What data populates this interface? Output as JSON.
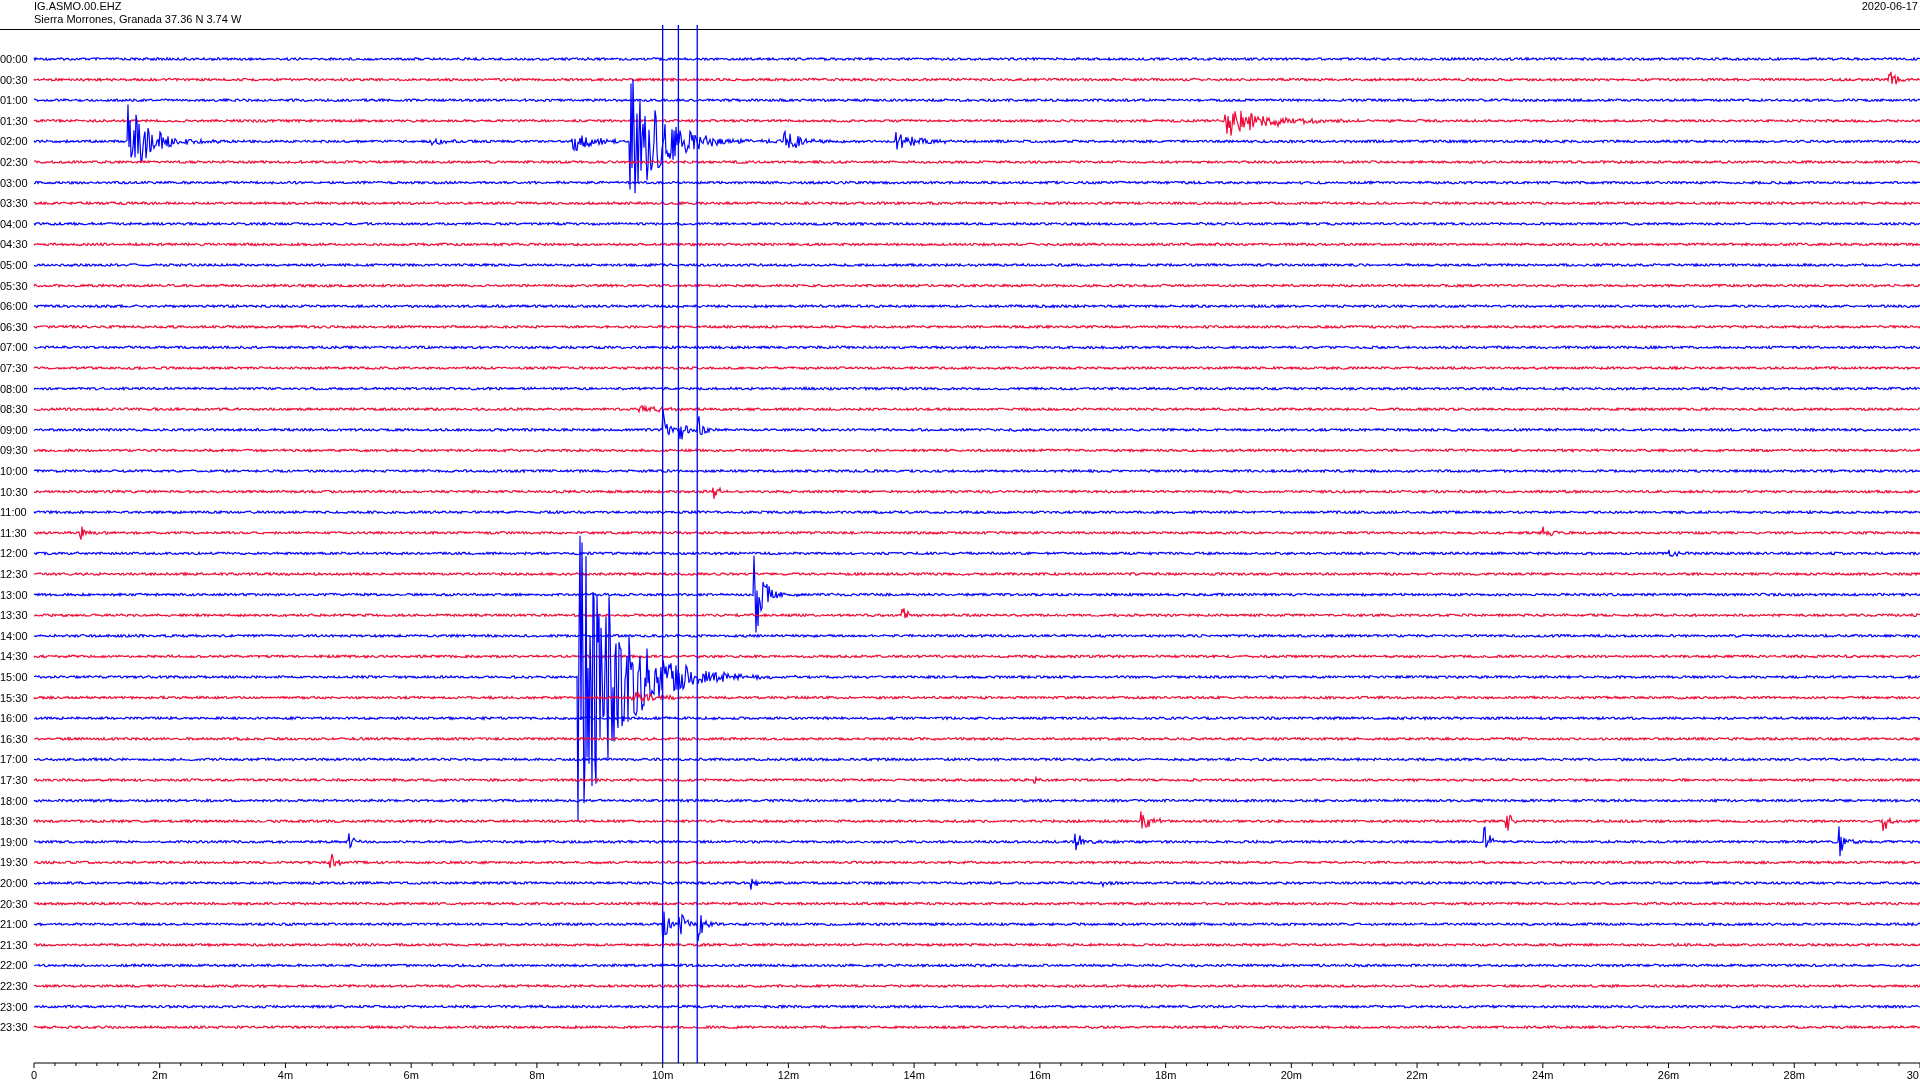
{
  "header": {
    "station": "IG.ASMO.00.EHZ",
    "location": "Sierra Morrones, Granada  37.36 N 3.74 W",
    "date": "2020-06-17"
  },
  "rows": [
    {
      "time": "00:00",
      "color": "#0000ff"
    },
    {
      "time": "00:30",
      "color": "#f00a36"
    },
    {
      "time": "01:00",
      "color": "#0000ff"
    },
    {
      "time": "01:30",
      "color": "#f00a36"
    },
    {
      "time": "02:00",
      "color": "#0000ff"
    },
    {
      "time": "02:30",
      "color": "#f00a36"
    },
    {
      "time": "03:00",
      "color": "#0000ff"
    },
    {
      "time": "03:30",
      "color": "#f00a36"
    },
    {
      "time": "04:00",
      "color": "#0000ff"
    },
    {
      "time": "04:30",
      "color": "#f00a36"
    },
    {
      "time": "05:00",
      "color": "#0000ff"
    },
    {
      "time": "05:30",
      "color": "#f00a36"
    },
    {
      "time": "06:00",
      "color": "#0000ff"
    },
    {
      "time": "06:30",
      "color": "#f00a36"
    },
    {
      "time": "07:00",
      "color": "#0000ff"
    },
    {
      "time": "07:30",
      "color": "#f00a36"
    },
    {
      "time": "08:00",
      "color": "#0000ff"
    },
    {
      "time": "08:30",
      "color": "#f00a36"
    },
    {
      "time": "09:00",
      "color": "#0000ff"
    },
    {
      "time": "09:30",
      "color": "#f00a36"
    },
    {
      "time": "10:00",
      "color": "#0000ff"
    },
    {
      "time": "10:30",
      "color": "#f00a36"
    },
    {
      "time": "11:00",
      "color": "#0000ff"
    },
    {
      "time": "11:30",
      "color": "#f00a36"
    },
    {
      "time": "12:00",
      "color": "#0000ff"
    },
    {
      "time": "12:30",
      "color": "#f00a36"
    },
    {
      "time": "13:00",
      "color": "#0000ff"
    },
    {
      "time": "13:30",
      "color": "#f00a36"
    },
    {
      "time": "14:00",
      "color": "#0000ff"
    },
    {
      "time": "14:30",
      "color": "#f00a36"
    },
    {
      "time": "15:00",
      "color": "#0000ff"
    },
    {
      "time": "15:30",
      "color": "#f00a36"
    },
    {
      "time": "16:00",
      "color": "#0000ff"
    },
    {
      "time": "16:30",
      "color": "#f00a36"
    },
    {
      "time": "17:00",
      "color": "#0000ff"
    },
    {
      "time": "17:30",
      "color": "#f00a36"
    },
    {
      "time": "18:00",
      "color": "#0000ff"
    },
    {
      "time": "18:30",
      "color": "#f00a36"
    },
    {
      "time": "19:00",
      "color": "#0000ff"
    },
    {
      "time": "19:30",
      "color": "#f00a36"
    },
    {
      "time": "20:00",
      "color": "#0000ff"
    },
    {
      "time": "20:30",
      "color": "#f00a36"
    },
    {
      "time": "21:00",
      "color": "#0000ff"
    },
    {
      "time": "21:30",
      "color": "#f00a36"
    },
    {
      "time": "22:00",
      "color": "#0000ff"
    },
    {
      "time": "22:30",
      "color": "#f00a36"
    },
    {
      "time": "23:00",
      "color": "#0000ff"
    },
    {
      "time": "23:30",
      "color": "#f00a36"
    }
  ],
  "x_axis": {
    "labels": [
      "0",
      "2m",
      "4m",
      "6m",
      "8m",
      "10m",
      "12m",
      "14m",
      "16m",
      "18m",
      "20m",
      "22m",
      "24m",
      "26m",
      "28m",
      "30"
    ]
  }
}
